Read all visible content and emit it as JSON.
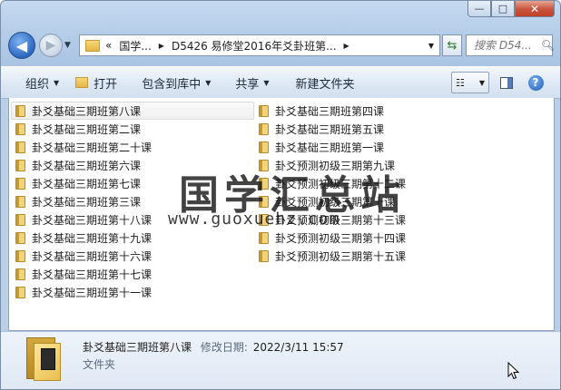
{
  "window": {
    "caption": {
      "minimize": "—",
      "maximize": "□",
      "close": "✕"
    }
  },
  "nav": {
    "back": "◀",
    "forward": "▶",
    "breadcrumb": [
      "«",
      "国学...",
      "D5426 易修堂2016年爻卦班第..."
    ],
    "search_placeholder": "搜索 D54..."
  },
  "toolbar": {
    "organize": "组织",
    "open": "打开",
    "include_in_library": "包含到库中",
    "share": "共享",
    "new_folder": "新建文件夹"
  },
  "files_col1": [
    "卦爻基础三期班第八课",
    "卦爻基础三期班第二课",
    "卦爻基础三期班第二十课",
    "卦爻基础三期班第六课",
    "卦爻基础三期班第七课",
    "卦爻基础三期班第三课",
    "卦爻基础三期班第十八课",
    "卦爻基础三期班第十九课",
    "卦爻基础三期班第十六课",
    "卦爻基础三期班第十七课",
    "卦爻基础三期班第十一课"
  ],
  "files_col2": [
    "卦爻基础三期班第四课",
    "卦爻基础三期班第五课",
    "卦爻基础三期班第一课",
    "卦爻预测初级三期第九课",
    "卦爻预测初级三期第十二课",
    "卦爻预测初级三期第十课",
    "卦爻预测初级三期第十三课",
    "卦爻预测初级三期第十四课",
    "卦爻预测初级三期第十五课"
  ],
  "watermark": {
    "title": "国学汇总站",
    "url": "www.guoxuehz.com"
  },
  "details": {
    "name": "卦爻基础三期班第八课",
    "modified_label": "修改日期:",
    "modified_value": "2022/3/11 15:57",
    "type": "文件夹"
  }
}
